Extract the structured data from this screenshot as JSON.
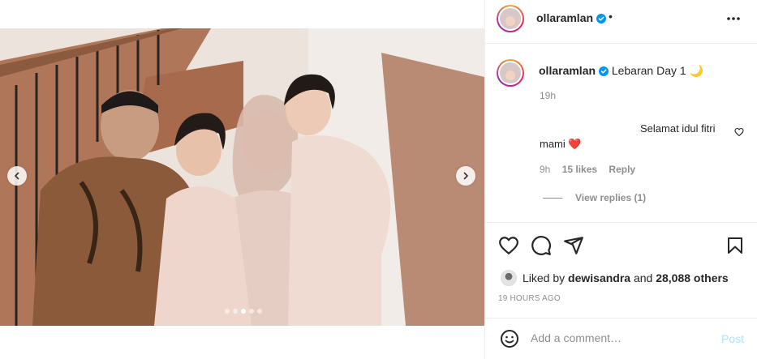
{
  "post": {
    "username": "ollaramlan",
    "header_separator": "•",
    "caption_text": "Lebaran Day 1 🌙",
    "caption_time": "19h",
    "carousel": {
      "total": 5,
      "active_index": 2
    }
  },
  "comment": {
    "text_line1": "Selamat idul fitri",
    "text_line2": "mami ❤️",
    "time": "9h",
    "likes": "15 likes",
    "reply_label": "Reply",
    "view_replies": "View replies (1)"
  },
  "likes": {
    "prefix": "Liked by",
    "user": "dewisandra",
    "middle": "and",
    "count": "28,088 others"
  },
  "timestamp": "19 HOURS AGO",
  "add_comment": {
    "placeholder": "Add a comment…",
    "post_label": "Post"
  },
  "colors": {
    "verified": "#0095f6",
    "post_disabled": "#b2dffc",
    "heart_red": "#e0245e",
    "secondary_text": "#8e8e8e"
  },
  "icons": [
    "verified-badge-icon",
    "more-options-icon",
    "heart-icon",
    "comment-icon",
    "share-icon",
    "bookmark-icon",
    "emoji-icon",
    "chevron-left-icon",
    "chevron-right-icon"
  ]
}
